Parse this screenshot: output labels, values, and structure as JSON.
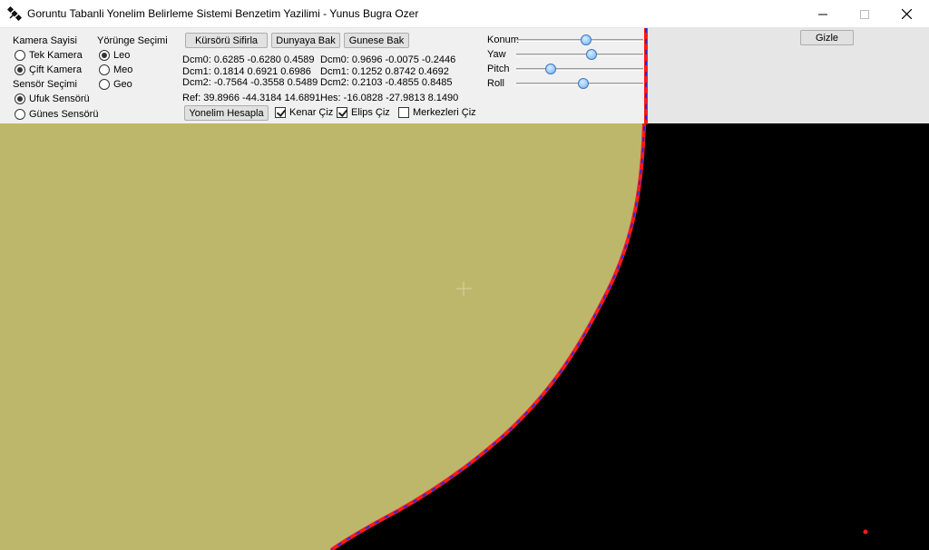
{
  "window": {
    "title": "Goruntu Tabanli Yonelim Belirleme Sistemi Benzetim Yazilimi - Yunus Bugra Ozer",
    "icon": "satellite-icon"
  },
  "camera_count": {
    "label": "Kamera Sayisi",
    "options": [
      {
        "label": "Tek Kamera",
        "selected": false
      },
      {
        "label": "Çift Kamera",
        "selected": true
      }
    ]
  },
  "sensor": {
    "label": "Sensör Seçimi",
    "options": [
      {
        "label": "Ufuk Sensörü",
        "selected": true
      },
      {
        "label": "Günes Sensörü",
        "selected": false
      }
    ]
  },
  "orbit": {
    "label": "Yörünge Seçimi",
    "options": [
      {
        "label": "Leo",
        "selected": true
      },
      {
        "label": "Meo",
        "selected": false
      },
      {
        "label": "Geo",
        "selected": false
      }
    ]
  },
  "buttons": {
    "reset_cursor": "Kürsörü Sifirla",
    "look_world": "Dunyaya Bak",
    "look_sun": "Gunese Bak",
    "compute": "Yonelim Hesapla",
    "hide": "Gizle"
  },
  "dcm_left": {
    "dcm0": "Dcm0: 0.6285 -0.6280 0.4589",
    "dcm1": "Dcm1: 0.1814 0.6921 0.6986",
    "dcm2": "Dcm2: -0.7564 -0.3558 0.5489",
    "ref": "Ref: 39.8966 -44.3184 14.6891"
  },
  "dcm_right": {
    "dcm0": "Dcm0: 0.9696 -0.0075 -0.2446",
    "dcm1": "Dcm1: 0.1252 0.8742 0.4692",
    "dcm2": "Dcm2: 0.2103 -0.4855 0.8485",
    "hes": "Hes: -16.0828 -27.9813 8.1490"
  },
  "checkboxes": [
    {
      "label": "Kenar Çiz",
      "checked": true
    },
    {
      "label": "Elips Çiz",
      "checked": true
    },
    {
      "label": "Merkezleri Çiz",
      "checked": false
    }
  ],
  "sliders": [
    {
      "label": "Konum",
      "value": 0.55
    },
    {
      "label": "Yaw",
      "value": 0.59
    },
    {
      "label": "Pitch",
      "value": 0.27
    },
    {
      "label": "Roll",
      "value": 0.53
    }
  ],
  "colors": {
    "earth": "#bdb76b",
    "space": "#000000",
    "edge_red": "#ff1a1a",
    "edge_blue": "#2a2adf",
    "panel_bg": "#f0f0f0"
  }
}
